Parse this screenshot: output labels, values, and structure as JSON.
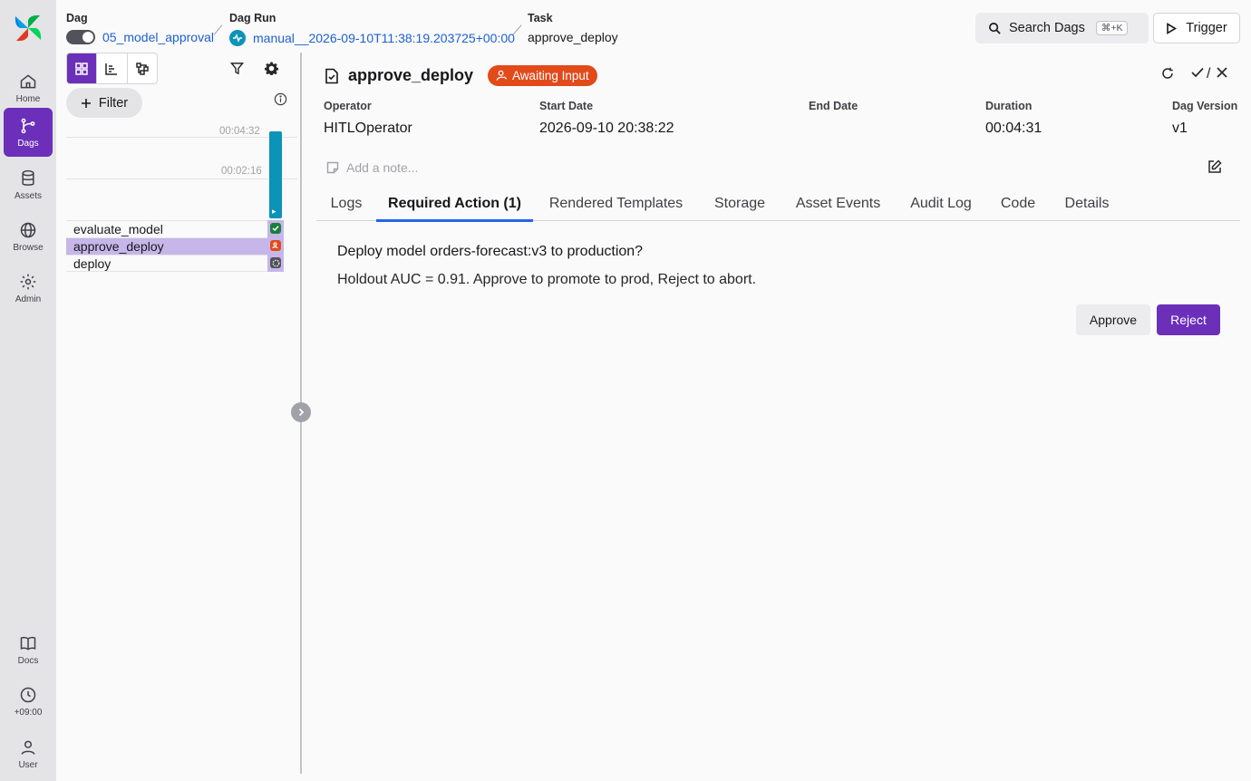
{
  "nav": {
    "items": [
      {
        "label": "Home",
        "icon": "home-icon"
      },
      {
        "label": "Dags",
        "icon": "dags-icon",
        "active": true
      },
      {
        "label": "Assets",
        "icon": "database-icon"
      },
      {
        "label": "Browse",
        "icon": "globe-icon"
      },
      {
        "label": "Admin",
        "icon": "gear-icon"
      }
    ],
    "bottom": [
      {
        "label": "Docs",
        "icon": "book-icon"
      },
      {
        "label": "+09:00",
        "icon": "clock-icon"
      },
      {
        "label": "User",
        "icon": "user-icon"
      }
    ]
  },
  "breadcrumb": {
    "dag": {
      "key": "Dag",
      "value": "05_model_approval"
    },
    "dag_run": {
      "key": "Dag Run",
      "value": "manual__2026-09-10T11:38:19.203725+00:00"
    },
    "task": {
      "key": "Task",
      "value": "approve_deploy"
    }
  },
  "header": {
    "search_label": "Search Dags",
    "search_shortcut": "⌘+K",
    "trigger_label": "Trigger"
  },
  "grid": {
    "filter_label": "Filter",
    "ticks": [
      "00:04:32",
      "00:02:16"
    ],
    "tasks": [
      {
        "name": "evaluate_model",
        "state": "success"
      },
      {
        "name": "approve_deploy",
        "state": "awaiting-input",
        "selected": true
      },
      {
        "name": "deploy",
        "state": "none"
      }
    ]
  },
  "task_details": {
    "title": "approve_deploy",
    "badge": "Awaiting Input",
    "separator": "/",
    "meta": [
      {
        "key": "Operator",
        "value": "HITLOperator"
      },
      {
        "key": "Start Date",
        "value": "2026-09-10 20:38:22"
      },
      {
        "key": "End Date",
        "value": ""
      },
      {
        "key": "Duration",
        "value": "00:04:31"
      },
      {
        "key": "Dag Version",
        "value": "v1"
      }
    ],
    "note_placeholder": "Add a note...",
    "tabs": [
      "Logs",
      "Required Action (1)",
      "Rendered Templates",
      "Storage",
      "Asset Events",
      "Audit Log",
      "Code",
      "Details"
    ],
    "active_tab": "Required Action (1)"
  },
  "required_action": {
    "question": "Deploy model orders-forecast:v3 to production?",
    "description": "Holdout AUC = 0.91. Approve to promote to prod, Reject to abort.",
    "approve_label": "Approve",
    "reject_label": "Reject"
  },
  "colors": {
    "accent": "#6b2fba",
    "running": "#0b93b8",
    "success": "#17803d",
    "awaiting": "#e24a1a",
    "link": "#1d5fd1",
    "tab_underline": "#2563eb"
  }
}
